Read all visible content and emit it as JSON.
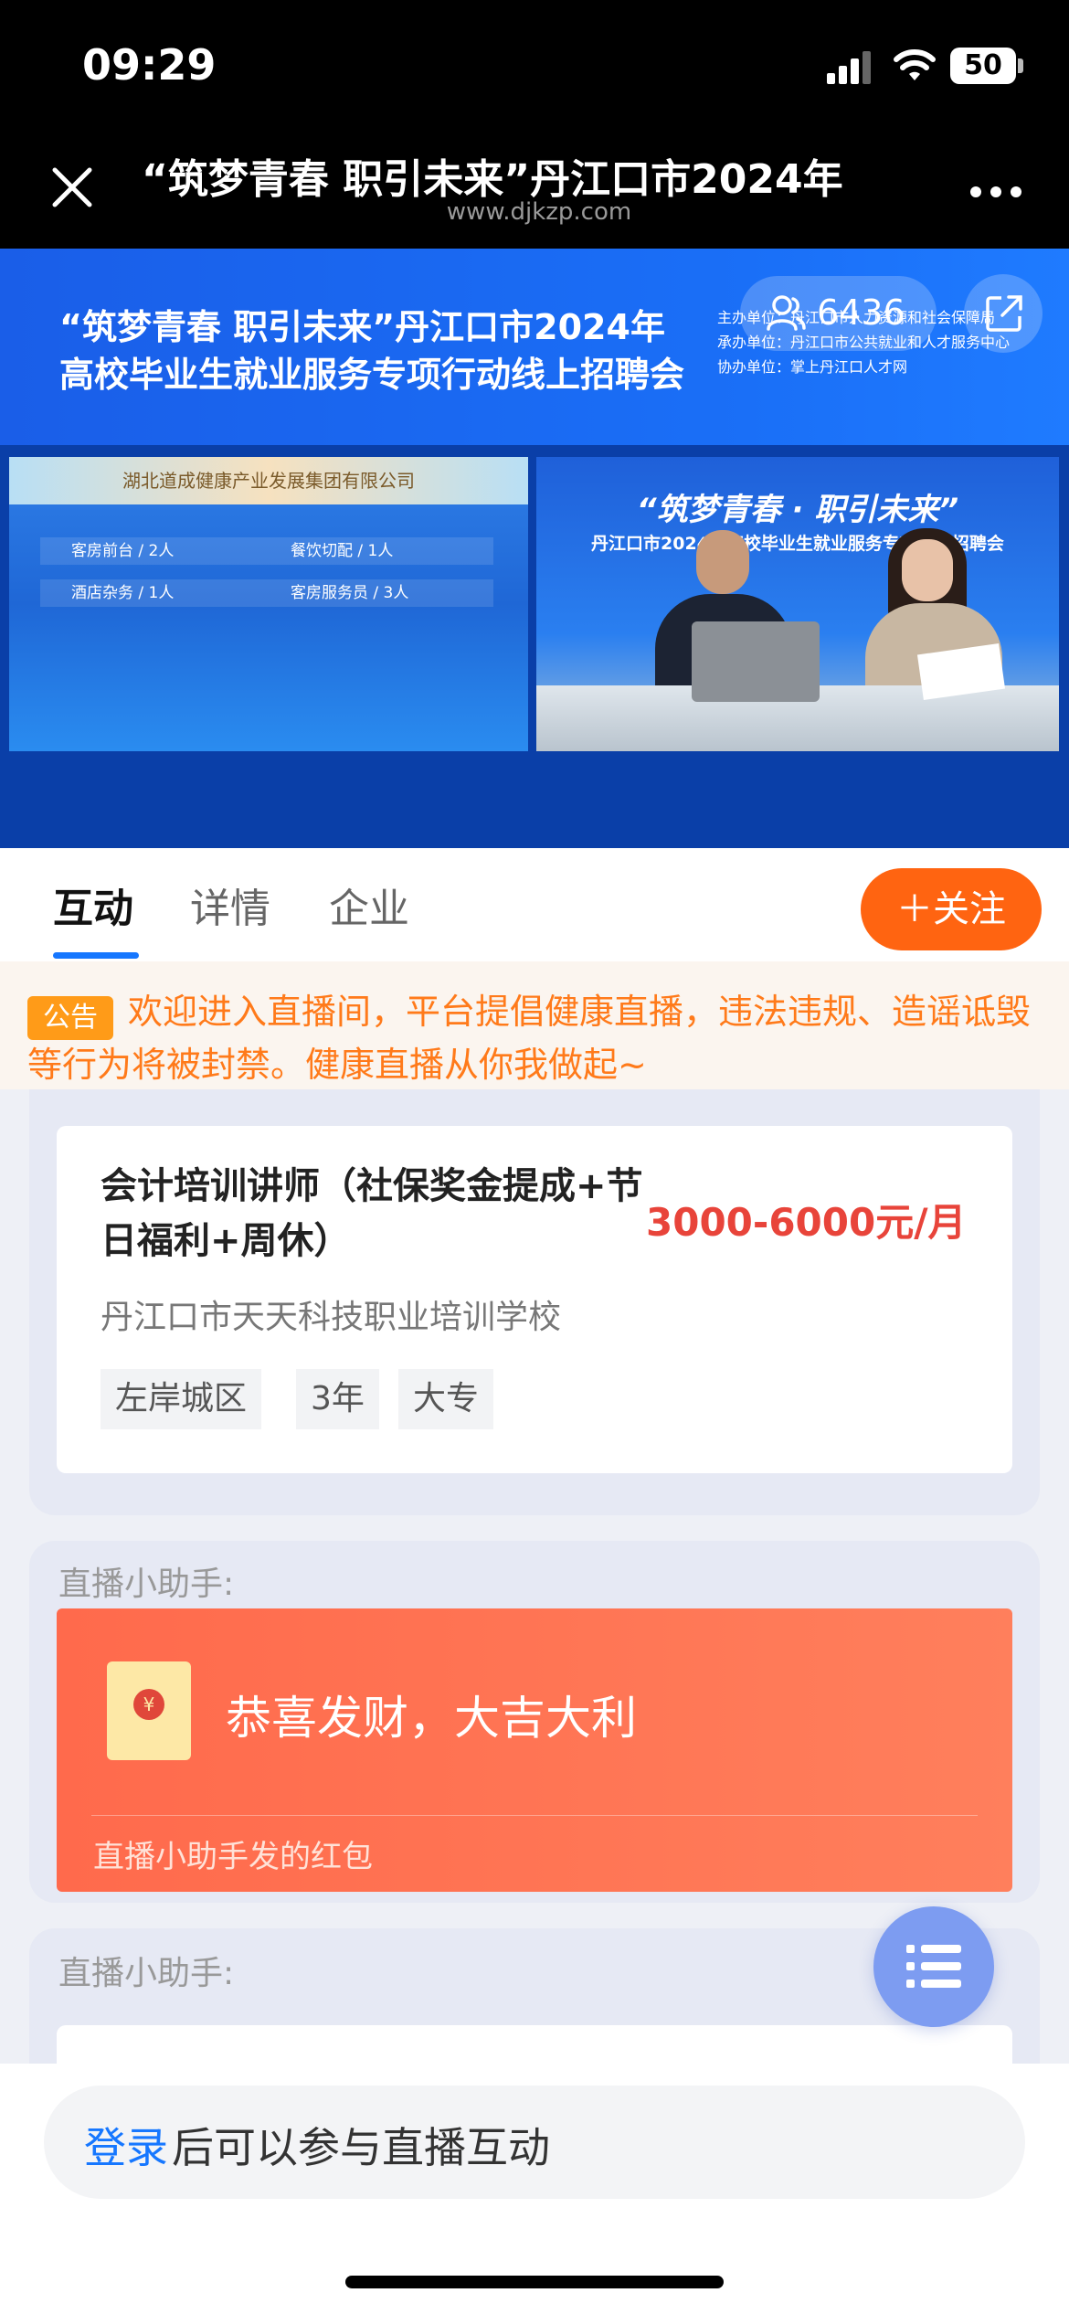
{
  "status_bar": {
    "time": "09:29",
    "battery": "50"
  },
  "nav": {
    "title": "“筑梦青春 职引未来”丹江口市2024年",
    "subtitle": "www.djkzp.com"
  },
  "video": {
    "banner_title_line1": "“筑梦青春  职引未来”丹江口市2024年",
    "banner_title_line2": "高校毕业生就业服务专项行动线上招聘会",
    "org_lines": [
      "主办单位：丹江口市人力资源和社会保障局",
      "承办单位：丹江口市公共就业和人才服务中心",
      "协办单位：掌上丹江口人才网"
    ],
    "viewer_count": "6436",
    "company_name": "湖北道成健康产业发展集团有限公司",
    "jobs": [
      {
        "left": "客房前台 / 2人",
        "right": "餐饮切配 / 1人"
      },
      {
        "left": "酒店杂务 / 1人",
        "right": "客房服务员 / 3人"
      }
    ],
    "studio_title1": "“筑梦青春 · 职引未来”",
    "studio_title2": "丹江口市2024年高校毕业生就业服务专项行动招聘会"
  },
  "tabs": [
    {
      "label": "互动",
      "active": true
    },
    {
      "label": "详情",
      "active": false
    },
    {
      "label": "企业",
      "active": false
    }
  ],
  "follow_button": "＋关注",
  "notice": {
    "badge": "公告",
    "text": "欢迎进入直播间，平台提倡健康直播，违法违规、造谣诋毁等行为将被封禁。健康直播从你我做起~"
  },
  "job_card": {
    "title": "会计培训讲师（社保奖金提成+节日福利+周休）",
    "salary": "3000-6000元/月",
    "company": "丹江口市天天科技职业培训学校",
    "tags": [
      "左岸城区",
      "3年",
      "大专"
    ]
  },
  "assistant_messages": [
    {
      "label": "直播小助手:",
      "red_packet_text": "恭喜发财，大吉大利",
      "red_packet_footer": "直播小助手发的红包"
    },
    {
      "label": "直播小助手:"
    }
  ],
  "bottom": {
    "login_link": "登录",
    "login_rest": "后可以参与直播互动"
  },
  "colors": {
    "accent": "#1677ff",
    "follow": "#ff6411",
    "salary": "#e8443a",
    "red_packet": "#ff6a4c",
    "notice_text": "#ff7a1a"
  }
}
